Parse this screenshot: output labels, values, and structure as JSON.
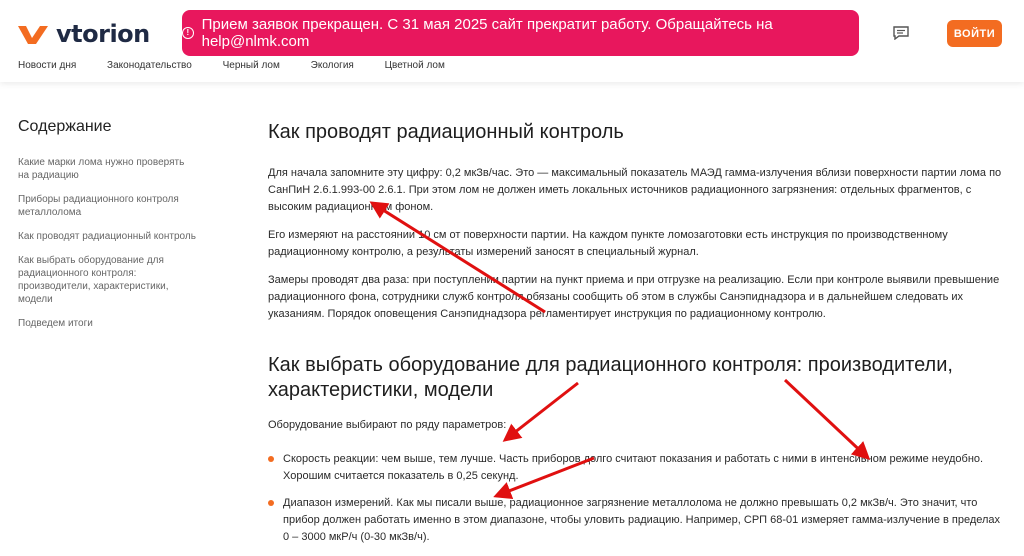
{
  "header": {
    "logo_text": "vtorion",
    "banner_text": "Прием заявок прекращен. С 31 мая 2025 сайт прекратит работу. Обращайтесь на help@nlmk.com",
    "login_label": "ВОЙТИ",
    "nav": [
      "Новости дня",
      "Законодательство",
      "Черный лом",
      "Экология",
      "Цветной лом"
    ]
  },
  "sidebar": {
    "title": "Содержание",
    "items": [
      "Какие марки лома нужно проверять на радиацию",
      "Приборы радиационного контроля металлолома",
      "Как проводят радиационный контроль",
      "Как выбрать оборудование для радиационного контроля: производители, характеристики, модели",
      "Подведем итоги"
    ]
  },
  "article": {
    "h1": "Как проводят радиационный контроль",
    "p1": "Для начала запомните эту цифру: 0,2 мкЗв/час. Это — максимальный показатель МАЭД гамма-излучения вблизи поверхности партии лома по СанПиН 2.6.1.993-00 2.6.1. При этом лом не должен иметь локальных источников радиационного загрязнения: отдельных фрагментов, с высоким радиационным фоном.",
    "p2": "Его измеряют на расстоянии 10 см от поверхности партии. На каждом пункте ломозаготовки есть инструкция по производственному радиационному контролю, а результаты измерений заносят в специальный журнал.",
    "p3": "Замеры проводят два раза: при поступлении партии на пункт приема и при отгрузке на реализацию. Если при контроле выявили превышение радиационного фона, сотрудники служб контроля обязаны сообщить об этом в службы Санэпиднадзора и в дальнейшем следовать их указаниям. Порядок оповещения Санэпиднадзора регламентирует инструкция по радиационному контролю.",
    "h2": "Как выбрать оборудование для радиационного контроля: производители, характеристики, модели",
    "p4": "Оборудование выбирают по ряду параметров:",
    "bullets": [
      "Скорость реакции: чем выше, тем лучше. Часть приборов долго считают показания и работать с ними в интенсивном режиме неудобно. Хорошим считается показатель в 0,25 секунд.",
      "Диапазон измерений. Как мы писали выше, радиационное загрязнение металлолома не должно превышать 0,2 мкЗв/ч. Это значит, что прибор должен работать именно в этом диапазоне, чтобы уловить радиацию. Например, СРП 68-01 измеряет гамма-излучение в пределах 0 – 3000 мкР/ч (0-30 мкЗв/ч)."
    ]
  },
  "colors": {
    "accent": "#f36c21",
    "banner": "#e8175d",
    "arrow": "#e01010"
  }
}
